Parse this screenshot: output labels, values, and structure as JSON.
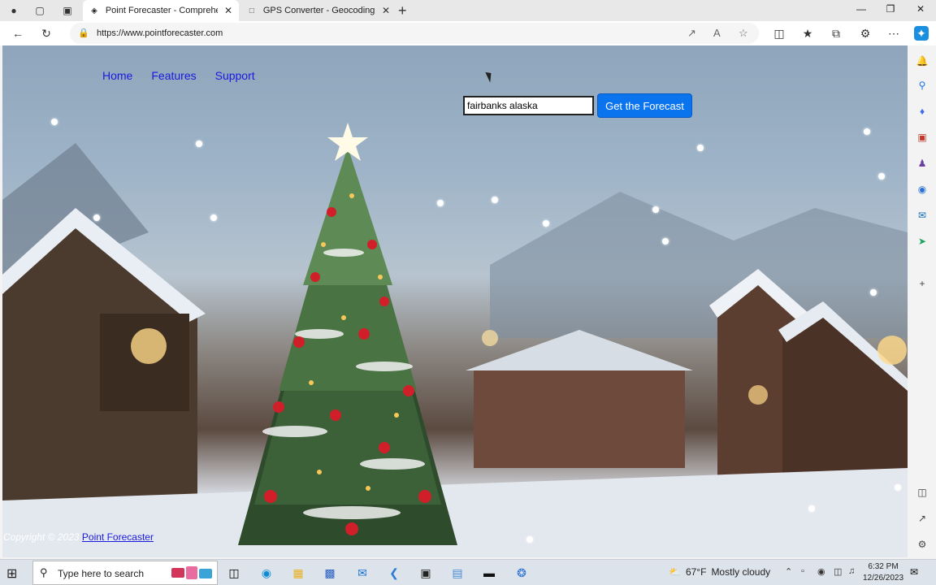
{
  "browser": {
    "tabs": [
      {
        "title": "Point Forecaster - Comprehensiv",
        "active": true
      },
      {
        "title": "GPS Converter - Geocoding, Rev",
        "active": false
      }
    ],
    "url": "https://www.pointforecaster.com"
  },
  "page": {
    "nav": [
      "Home",
      "Features",
      "Support"
    ],
    "search": {
      "value": "fairbanks alaska"
    },
    "forecast_button": "Get the Forecast",
    "footer": {
      "copyright": "Copyright © 2023",
      "link": "Point Forecaster"
    }
  },
  "taskbar": {
    "search_placeholder": "Type here to search",
    "weather": {
      "temp": "67°F",
      "condition": "Mostly cloudy"
    },
    "time": "6:32 PM",
    "date": "12/26/2023"
  },
  "colors": {
    "accent": "#0a74ef",
    "link": "#1a1adf"
  }
}
